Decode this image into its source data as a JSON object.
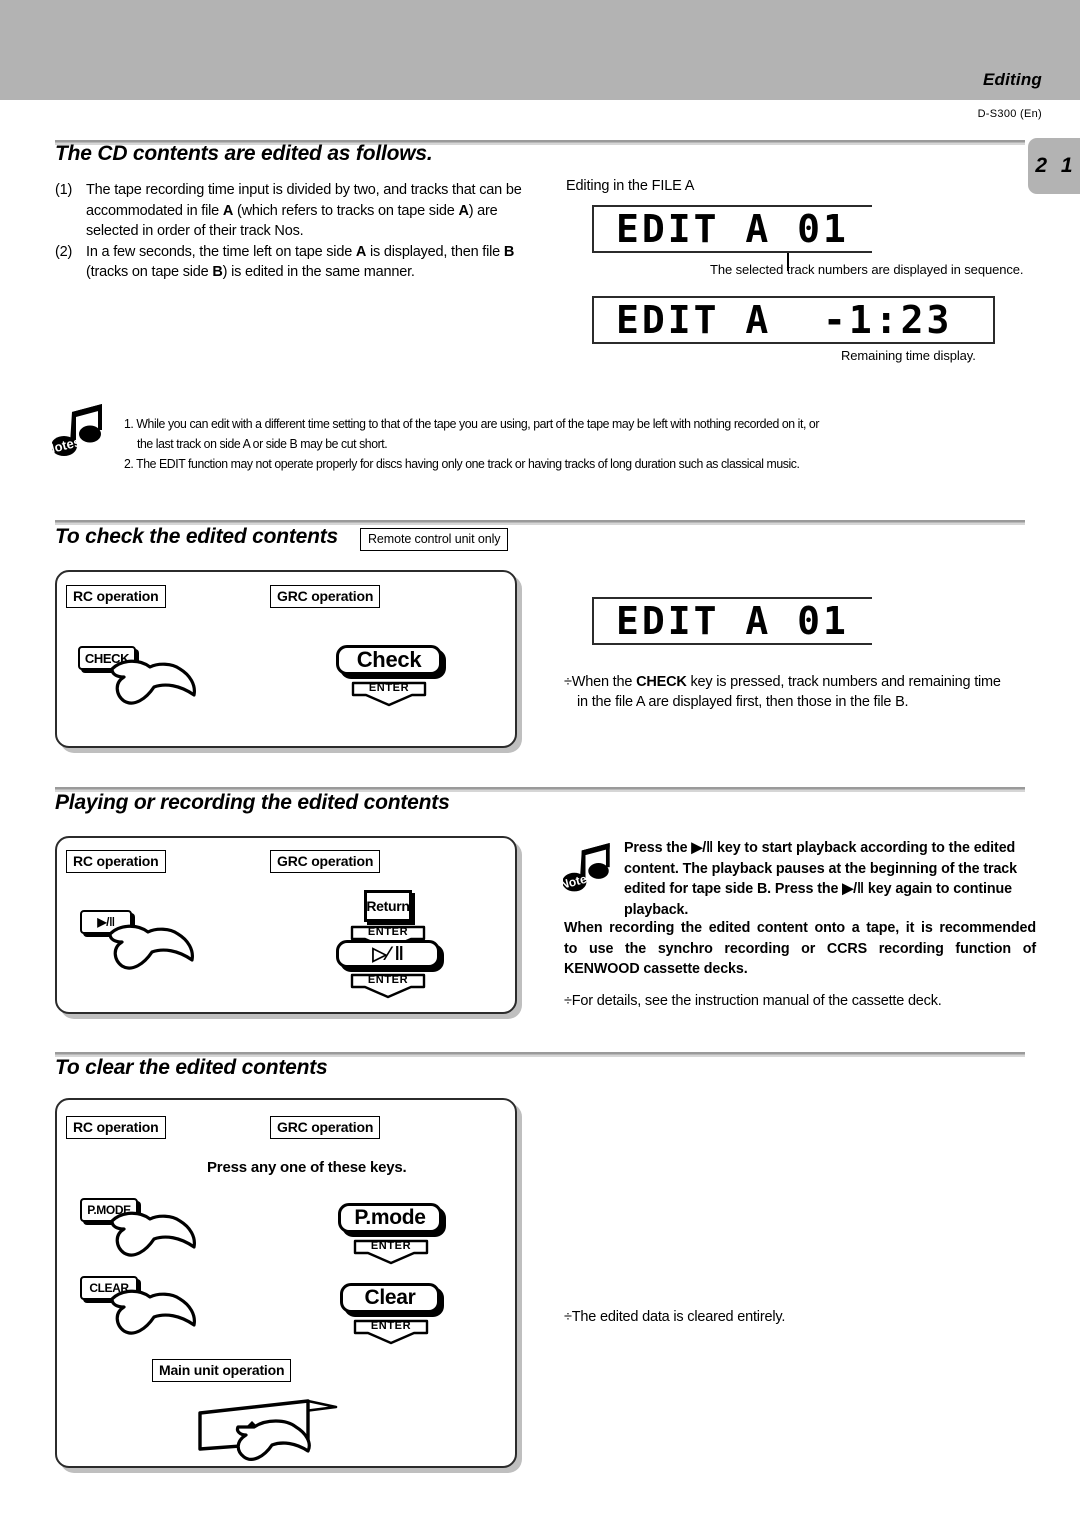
{
  "header": {
    "banner_title": "Editing",
    "model": "D-S300  (En)",
    "page_number": "2 1"
  },
  "section1": {
    "heading": "The CD contents are edited as follows.",
    "items": [
      {
        "marker": "(1)",
        "lines": [
          "The tape recording time input is divided by two, and tracks that can",
          "be accommodated in file A (which refers to tracks on tape side A) are",
          "selected in order of their track Nos."
        ]
      },
      {
        "marker": "(2)",
        "lines": [
          "In a few seconds, the time left on tape side A is displayed, then file",
          "B (tracks on tape side B) is edited in the same manner."
        ]
      }
    ],
    "editing_label": "Editing in the FILE A",
    "display1": "EDIT A 01",
    "caption1": "The selected track numbers are displayed in sequence.",
    "display2": "EDIT A  -1:23",
    "caption2": "Remaining time display."
  },
  "notes_block": {
    "icon_label": "Notes",
    "items": [
      "1. While you can edit with a different time setting to that of the tape you are using, part of the tape may be left with nothing recorded on it, or",
      "the last track on side A or side B may be cut short.",
      "2. The EDIT function may not operate properly for discs having only one track or having tracks of long duration such as classical music."
    ]
  },
  "section2": {
    "heading": "To check the edited contents",
    "tag": "Remote control unit only",
    "rc_label": "RC operation",
    "grc_label": "GRC operation",
    "rc_key": "CHECK",
    "grc_button": "Check",
    "enter": "ENTER",
    "display": "EDIT A 01",
    "bullet_symbol": "÷",
    "bullet_lines": [
      "When the CHECK key is pressed, track numbers and remaining time",
      "in the file A are displayed first, then those in the file B."
    ],
    "bullet_bold_word": "CHECK"
  },
  "section3": {
    "heading": "Playing or recording the edited contents",
    "rc_label": "RC operation",
    "grc_label": "GRC operation",
    "rc_key": "▶/‖",
    "grc_return": "Return",
    "grc_play": "▷⁄ ‖",
    "enter": "ENTER",
    "note_icon_label": "Note",
    "note_lines": [
      "Press the ▶/‖ key to start playback according to the edited",
      "content. The playback pauses at the beginning of the track",
      "edited for tape side B. Press the ▶/‖ key again to continue",
      "playback."
    ],
    "recommend_lines": [
      "When recording the edited content onto a tape, it is recommended",
      "to use the synchro recording or CCRS recording function of",
      "KENWOOD cassette decks."
    ],
    "bullet_symbol": "÷",
    "bullet_text": "For details, see the instruction manual of the cassette deck."
  },
  "section4": {
    "heading": "To clear the edited contents",
    "rc_label": "RC operation",
    "grc_label": "GRC operation",
    "press_any": "Press any one of these keys.",
    "rc_key1": "P.MODE",
    "rc_key2": "CLEAR",
    "grc_button1": "P.mode",
    "grc_button2": "Clear",
    "enter": "ENTER",
    "main_unit_label": "Main unit operation",
    "bullet_symbol": "÷",
    "bullet_text": "The edited data is cleared entirely."
  }
}
